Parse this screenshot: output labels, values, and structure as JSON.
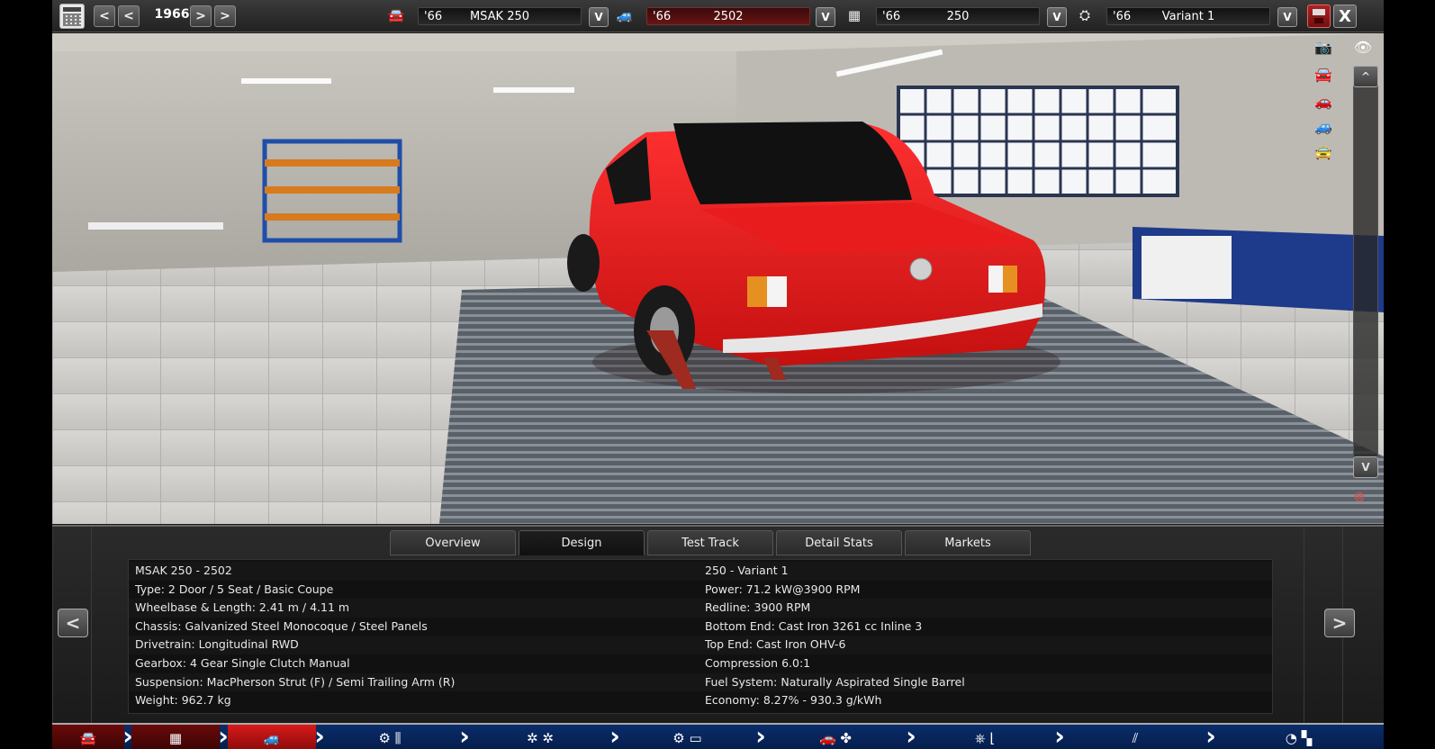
{
  "topbar": {
    "prev_decade": "<",
    "prev_year": "<",
    "year": "1966",
    "next_year": ">",
    "next_decade": ">",
    "model": {
      "year": "'66",
      "name": "MSAK 250"
    },
    "trim": {
      "year": "'66",
      "name": "2502"
    },
    "engine": {
      "year": "'66",
      "name": "250"
    },
    "variant": {
      "year": "'66",
      "name": "Variant 1"
    },
    "dropdown_label": "V",
    "close_label": "X"
  },
  "viewport": {
    "scroll_up": "^",
    "scroll_down": "V"
  },
  "tabs": [
    "Overview",
    "Design",
    "Test Track",
    "Detail Stats",
    "Markets"
  ],
  "active_tab": "Design",
  "stats": {
    "left": [
      "MSAK 250 - 2502",
      "Type: 2 Door / 5 Seat / Basic Coupe",
      "Wheelbase & Length: 2.41 m / 4.11 m",
      "Chassis: Galvanized Steel Monocoque / Steel Panels",
      "Drivetrain: Longitudinal RWD",
      "Gearbox: 4 Gear Single Clutch Manual",
      "Suspension: MacPherson Strut (F) / Semi Trailing Arm (R)",
      "Weight: 962.7 kg"
    ],
    "right": [
      "250 - Variant 1",
      "Power: 71.2 kW@3900 RPM",
      "Redline: 3900 RPM",
      "Bottom End: Cast Iron 3261 cc Inline 3",
      "Top End: Cast Iron OHV-6",
      "Compression 6.0:1",
      "Fuel System: Naturally Aspirated Single Barrel",
      "Economy: 8.27% - 930.3 g/kWh"
    ]
  },
  "panel_nav": {
    "prev": "<",
    "next": ">"
  },
  "bottom_steps": [
    {
      "icon": "car-icon",
      "glyph": "🚘",
      "state": "done"
    },
    {
      "icon": "chassis-icon",
      "glyph": "▦",
      "state": "done"
    },
    {
      "icon": "car-body-icon",
      "glyph": "🚙",
      "state": "current"
    },
    {
      "icon": "engine-icon",
      "glyph": "⚙ ⫼",
      "state": "todo"
    },
    {
      "icon": "wheels-icon",
      "glyph": "✲ ✲",
      "state": "todo"
    },
    {
      "icon": "engine-block-icon",
      "glyph": "⚙ ▭",
      "state": "todo"
    },
    {
      "icon": "car-fan-icon",
      "glyph": "🚗 ✤",
      "state": "todo"
    },
    {
      "icon": "steering-icon",
      "glyph": "⎈ ⌊",
      "state": "todo"
    },
    {
      "icon": "exhaust-icon",
      "glyph": "⫽",
      "state": "todo"
    },
    {
      "icon": "finish-flag-icon",
      "glyph": "◔ ▚",
      "state": "todo"
    }
  ],
  "colors": {
    "accent_red": "#d81a1a",
    "nav_blue": "#0a2d6a",
    "car_red": "#e01a1a"
  }
}
